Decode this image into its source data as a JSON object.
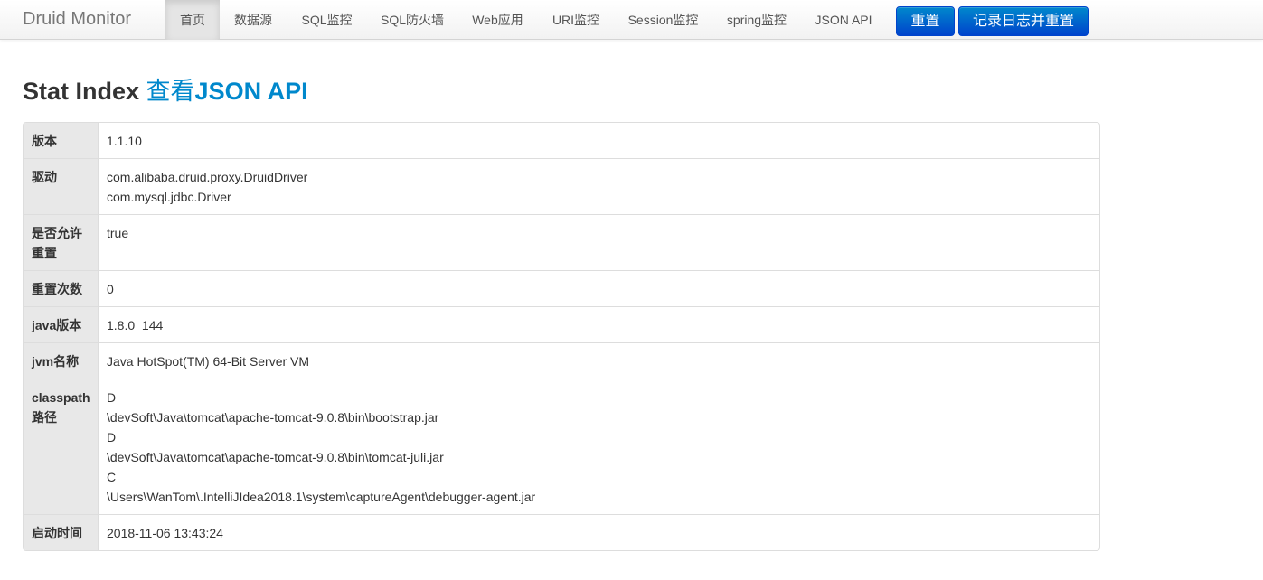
{
  "navbar": {
    "brand": "Druid Monitor",
    "items": [
      {
        "label": "首页"
      },
      {
        "label": "数据源"
      },
      {
        "label": "SQL监控"
      },
      {
        "label": "SQL防火墙"
      },
      {
        "label": "Web应用"
      },
      {
        "label": "URI监控"
      },
      {
        "label": "Session监控"
      },
      {
        "label": "spring监控"
      },
      {
        "label": "JSON API"
      }
    ],
    "reset_button": "重置",
    "log_reset_button": "记录日志并重置",
    "active_item": "首页"
  },
  "page": {
    "title": "Stat Index",
    "link_prefix": "查看",
    "link_text": "JSON API"
  },
  "table": {
    "rows": [
      {
        "label": "版本",
        "values": [
          "1.1.10"
        ]
      },
      {
        "label": "驱动",
        "values": [
          "com.alibaba.druid.proxy.DruidDriver",
          "com.mysql.jdbc.Driver"
        ]
      },
      {
        "label": "是否允许重置",
        "values": [
          "true"
        ]
      },
      {
        "label": "重置次数",
        "values": [
          "0"
        ]
      },
      {
        "label": "java版本",
        "values": [
          "1.8.0_144"
        ]
      },
      {
        "label": "jvm名称",
        "values": [
          "Java HotSpot(TM) 64-Bit Server VM"
        ]
      },
      {
        "label": "classpath路径",
        "values": [
          "D",
          "\\devSoft\\Java\\tomcat\\apache-tomcat-9.0.8\\bin\\bootstrap.jar",
          "D",
          "\\devSoft\\Java\\tomcat\\apache-tomcat-9.0.8\\bin\\tomcat-juli.jar",
          "C",
          "\\Users\\WanTom\\.IntelliJIdea2018.1\\system\\captureAgent\\debugger-agent.jar"
        ]
      },
      {
        "label": "启动时间",
        "values": [
          "2018-11-06 13:43:24"
        ]
      }
    ]
  },
  "colors": {
    "link": "#0088cc",
    "button": "#0055cc",
    "header_cell": "#e8e8e8"
  }
}
